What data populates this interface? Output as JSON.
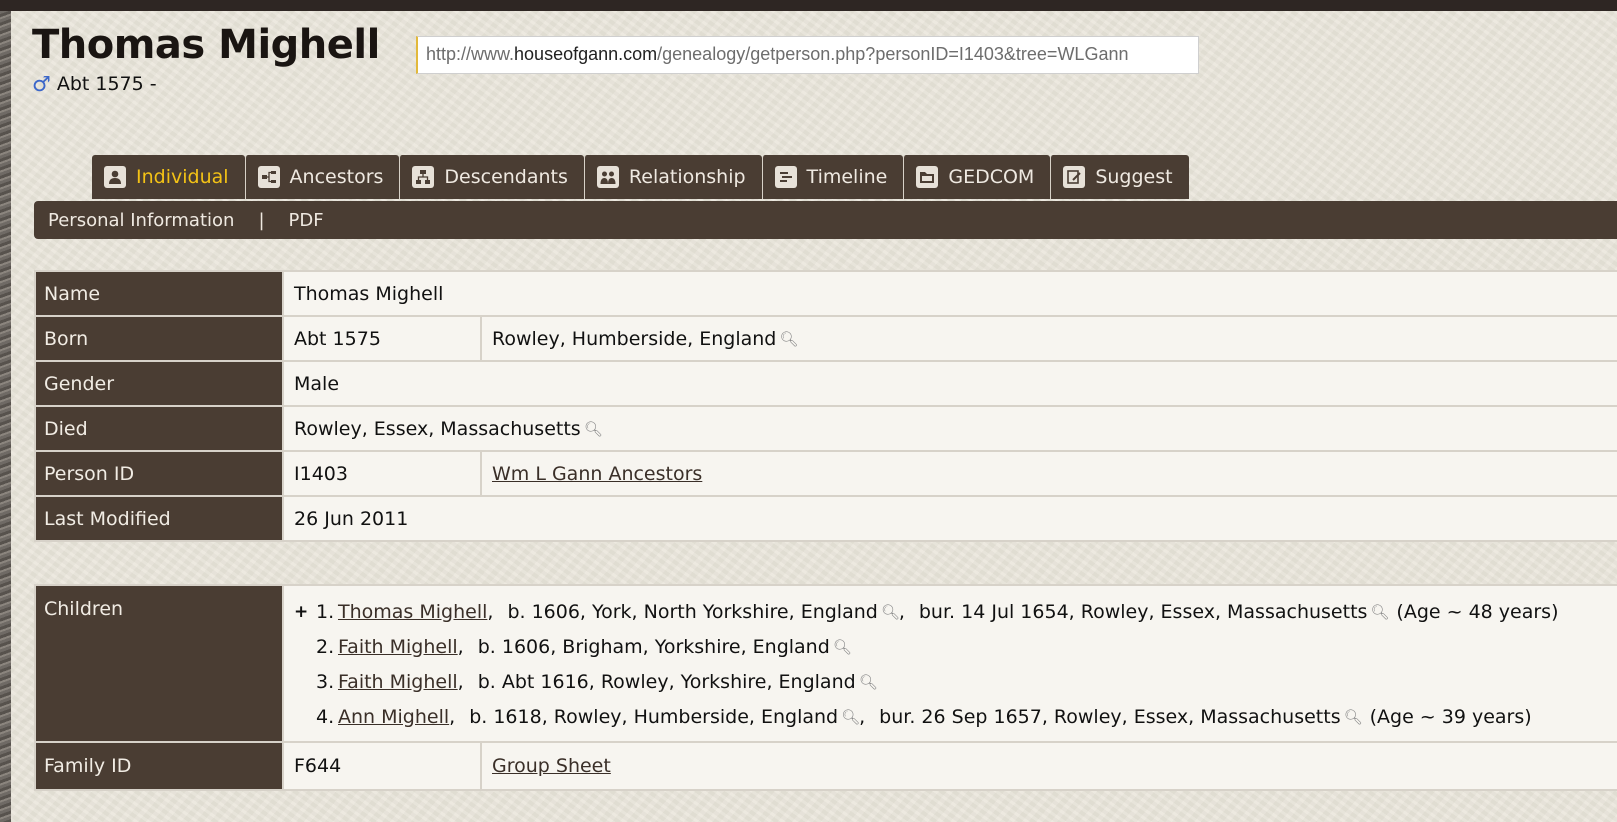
{
  "person": {
    "name": "Thomas Mighell",
    "gender_symbol": "♂",
    "lifespan": "Abt 1575 -"
  },
  "url": {
    "prefix": "http://www.",
    "host": "houseofgann.com",
    "path": "/genealogy/getperson.php?personID=I1403&tree=WLGann"
  },
  "tabs": [
    {
      "label": "Individual",
      "icon": "person-icon"
    },
    {
      "label": "Ancestors",
      "icon": "ancestors-tree-icon"
    },
    {
      "label": "Descendants",
      "icon": "descendants-tree-icon"
    },
    {
      "label": "Relationship",
      "icon": "relationship-icon"
    },
    {
      "label": "Timeline",
      "icon": "timeline-icon"
    },
    {
      "label": "GEDCOM",
      "icon": "folder-icon"
    },
    {
      "label": "Suggest",
      "icon": "edit-note-icon"
    }
  ],
  "subnav": {
    "personal": "Personal Information",
    "sep": "|",
    "pdf": "PDF"
  },
  "info": {
    "name_label": "Name",
    "name_value": "Thomas Mighell",
    "born_label": "Born",
    "born_date": "Abt 1575",
    "born_place": "Rowley, Humberside, England",
    "gender_label": "Gender",
    "gender_value": "Male",
    "died_label": "Died",
    "died_place": "Rowley, Essex, Massachusetts",
    "id_label": "Person ID",
    "id_value": "I1403",
    "tree_link": "Wm L Gann Ancestors",
    "mod_label": "Last Modified",
    "mod_value": "26 Jun 2011"
  },
  "family": {
    "children_label": "Children",
    "children": [
      {
        "plus": "+",
        "num": "1.",
        "name": "Thomas Mighell",
        "sep": ",",
        "birth": "b. 1606, York, North Yorkshire, England",
        "burial": "bur. 14 Jul 1654, Rowley, Essex, Massachusetts",
        "age": "(Age ~ 48 years)"
      },
      {
        "plus": "",
        "num": "2.",
        "name": "Faith Mighell",
        "sep": ",",
        "birth": "b. 1606, Brigham, Yorkshire, England",
        "burial": "",
        "age": ""
      },
      {
        "plus": "",
        "num": "3.",
        "name": "Faith Mighell",
        "sep": ",",
        "birth": "b. Abt 1616, Rowley, Yorkshire, England",
        "burial": "",
        "age": ""
      },
      {
        "plus": "",
        "num": "4.",
        "name": "Ann Mighell",
        "sep": ",",
        "birth": "b. 1618, Rowley, Humberside, England",
        "burial": "bur. 26 Sep 1657, Rowley, Essex, Massachusetts",
        "age": "(Age ~ 39 years)"
      }
    ],
    "family_id_label": "Family ID",
    "family_id_value": "F644",
    "group_sheet": "Group Sheet"
  },
  "colors": {
    "accent": "#f3c216",
    "header_bg": "#4a3d33",
    "page_bg": "#e9e5da",
    "male": "#3b66c9"
  }
}
